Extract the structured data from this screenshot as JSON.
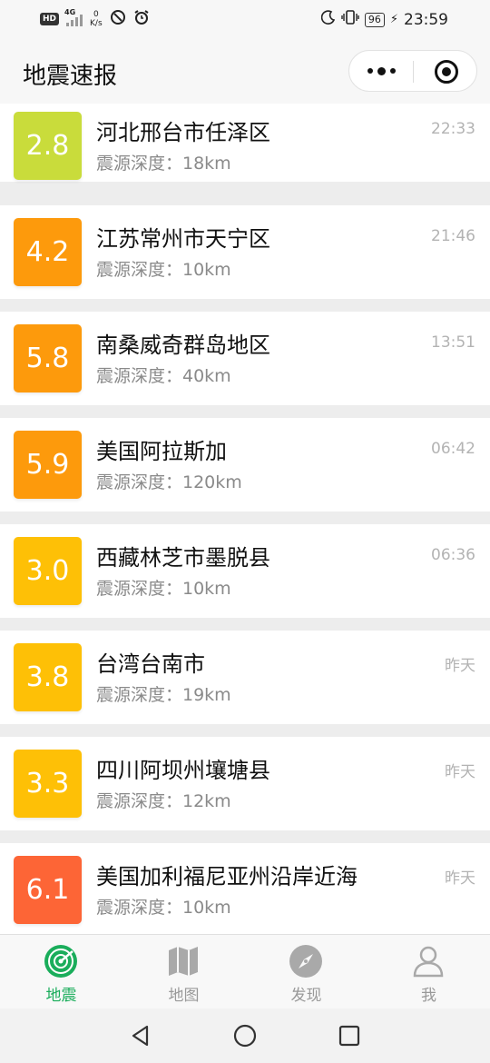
{
  "status_bar": {
    "hd": "HD",
    "network": "4G",
    "speed_value": "0",
    "speed_unit": "K/s",
    "battery": "96",
    "time": "23:59",
    "icons": [
      "hd-icon",
      "signal-icon",
      "speed-icon",
      "dnd-icon",
      "alarm-icon",
      "moon-icon",
      "vibrate-icon",
      "battery-icon",
      "charging-icon"
    ]
  },
  "header": {
    "title": "地震速报",
    "more_icon": "more-dots-icon",
    "close_icon": "target-icon"
  },
  "colors": {
    "minor": "#c8dc3a",
    "light": "#ffbf00",
    "moderate": "#ff9500",
    "strong": "#ff6434",
    "active_tab": "#1aad5b"
  },
  "quakes": [
    {
      "magnitude": "2.8",
      "place": "河北邢台市任泽区",
      "depth": "震源深度：18km",
      "time": "22:33",
      "color": "#c9dc3b"
    },
    {
      "magnitude": "4.2",
      "place": "江苏常州市天宁区",
      "depth": "震源深度：10km",
      "time": "21:46",
      "color": "#fd9a0c"
    },
    {
      "magnitude": "5.8",
      "place": "南桑威奇群岛地区",
      "depth": "震源深度：40km",
      "time": "13:51",
      "color": "#fd9a0c"
    },
    {
      "magnitude": "5.9",
      "place": "美国阿拉斯加",
      "depth": "震源深度：120km",
      "time": "06:42",
      "color": "#fd9a0c"
    },
    {
      "magnitude": "3.0",
      "place": "西藏林芝市墨脱县",
      "depth": "震源深度：10km",
      "time": "06:36",
      "color": "#fec006"
    },
    {
      "magnitude": "3.8",
      "place": "台湾台南市",
      "depth": "震源深度：19km",
      "time": "昨天",
      "color": "#fec006"
    },
    {
      "magnitude": "3.3",
      "place": "四川阿坝州壤塘县",
      "depth": "震源深度：12km",
      "time": "昨天",
      "color": "#fec006"
    },
    {
      "magnitude": "6.1",
      "place": "美国加利福尼亚州沿岸近海",
      "depth": "震源深度：10km",
      "time": "昨天",
      "color": "#fd6536"
    }
  ],
  "tabs": [
    {
      "label": "地震",
      "icon": "radar-icon",
      "active": true
    },
    {
      "label": "地图",
      "icon": "map-icon",
      "active": false
    },
    {
      "label": "发现",
      "icon": "compass-icon",
      "active": false
    },
    {
      "label": "我",
      "icon": "user-icon",
      "active": false
    }
  ],
  "nav_bar": {
    "back_icon": "back-triangle-icon",
    "home_icon": "home-circle-icon",
    "recents_icon": "recents-square-icon"
  }
}
